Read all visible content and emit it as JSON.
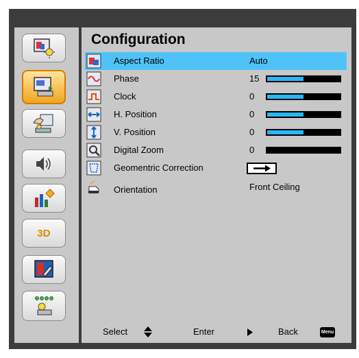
{
  "menu": {
    "title": "Configuration",
    "rows": [
      {
        "label": "Aspect Ratio",
        "value": "Auto",
        "icon": "aspect-ratio-icon"
      },
      {
        "label": "Phase",
        "value": "15",
        "level": 0.5,
        "icon": "phase-icon"
      },
      {
        "label": "Clock",
        "value": "0",
        "level": 0.5,
        "icon": "clock-icon"
      },
      {
        "label": "H. Position",
        "value": "0",
        "level": 0.5,
        "icon": "h-position-icon"
      },
      {
        "label": "V. Position",
        "value": "0",
        "level": 0.5,
        "icon": "v-position-icon"
      },
      {
        "label": "Digital Zoom",
        "value": "0",
        "level": 0.0,
        "icon": "digital-zoom-icon"
      },
      {
        "label": "Geomentric Correction",
        "value": "",
        "icon": "geometric-correction-icon"
      },
      {
        "label": "Orientation",
        "value": "Front Ceiling",
        "icon": "orientation-icon"
      }
    ]
  },
  "sidebar": {
    "items": [
      {
        "name": "image-settings",
        "icon": "image-settings-icon",
        "active": false
      },
      {
        "name": "configuration",
        "icon": "configuration-icon",
        "active": true
      },
      {
        "name": "installation",
        "icon": "installation-icon",
        "active": false
      },
      {
        "name": "audio",
        "icon": "audio-icon",
        "active": false
      },
      {
        "name": "options",
        "icon": "options-icon",
        "active": false
      },
      {
        "name": "3d",
        "icon": "3d-icon",
        "label": "3D",
        "active": false
      },
      {
        "name": "color",
        "icon": "color-icon",
        "active": false
      },
      {
        "name": "network",
        "icon": "network-icon",
        "active": false
      }
    ]
  },
  "footer": {
    "select_label": "Select",
    "enter_label": "Enter",
    "back_label": "Back",
    "menu_key_label": "Menu"
  },
  "colors": {
    "selection": "#4fc3f7",
    "bar_fill": "#29b6f6",
    "active_tab": "#f2a51d"
  }
}
